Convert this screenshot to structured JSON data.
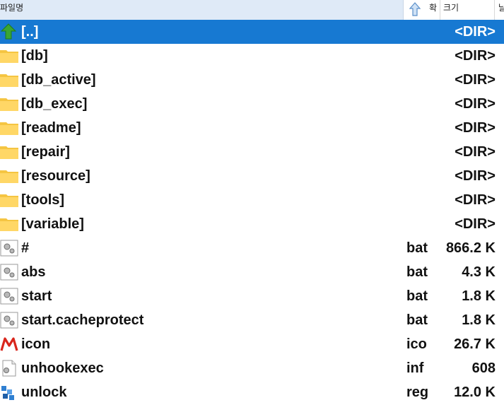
{
  "header": {
    "name_label": "파일명",
    "ext_label": "확",
    "size_label": "크기",
    "date_label": "날"
  },
  "rows": [
    {
      "name": "[..]",
      "ext": "",
      "size": "<DIR>",
      "icon": "up-arrow-icon",
      "selected": true
    },
    {
      "name": "[db]",
      "ext": "",
      "size": "<DIR>",
      "icon": "folder-icon"
    },
    {
      "name": "[db_active]",
      "ext": "",
      "size": "<DIR>",
      "icon": "folder-icon"
    },
    {
      "name": "[db_exec]",
      "ext": "",
      "size": "<DIR>",
      "icon": "folder-icon"
    },
    {
      "name": "[readme]",
      "ext": "",
      "size": "<DIR>",
      "icon": "folder-icon"
    },
    {
      "name": "[repair]",
      "ext": "",
      "size": "<DIR>",
      "icon": "folder-icon"
    },
    {
      "name": "[resource]",
      "ext": "",
      "size": "<DIR>",
      "icon": "folder-icon"
    },
    {
      "name": "[tools]",
      "ext": "",
      "size": "<DIR>",
      "icon": "folder-icon"
    },
    {
      "name": "[variable]",
      "ext": "",
      "size": "<DIR>",
      "icon": "folder-icon"
    },
    {
      "name": "#",
      "ext": "bat",
      "size": "866.2 K",
      "icon": "batch-gear-icon"
    },
    {
      "name": "abs",
      "ext": "bat",
      "size": "4.3 K",
      "icon": "batch-gear-icon"
    },
    {
      "name": "start",
      "ext": "bat",
      "size": "1.8 K",
      "icon": "batch-gear-icon"
    },
    {
      "name": "start.cacheprotect",
      "ext": "bat",
      "size": "1.8 K",
      "icon": "batch-gear-icon"
    },
    {
      "name": "icon",
      "ext": "ico",
      "size": "26.7 K",
      "icon": "ico-file-icon"
    },
    {
      "name": "unhookexec",
      "ext": "inf",
      "size": "608",
      "icon": "inf-file-icon"
    },
    {
      "name": "unlock",
      "ext": "reg",
      "size": "12.0 K",
      "icon": "registry-file-icon"
    }
  ],
  "colors": {
    "selection": "#1779d2",
    "folder": "#f5c542",
    "up_arrow": "#3aa534",
    "ico_red": "#d9261c",
    "reg_blue": "#2f7fd1"
  }
}
